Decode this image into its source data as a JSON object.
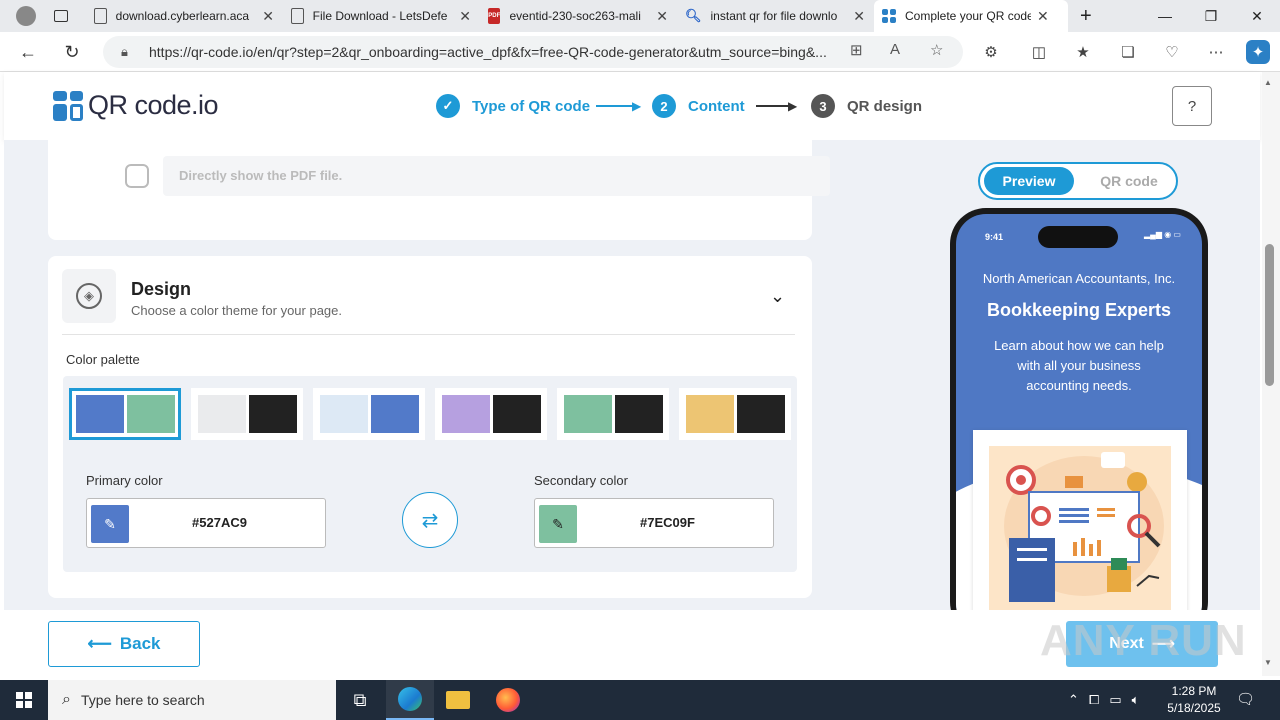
{
  "browser": {
    "tabs": [
      {
        "title": "download.cyberlearn.aca",
        "icon": "page-icon"
      },
      {
        "title": "File Download - LetsDefe",
        "icon": "page-icon"
      },
      {
        "title": "eventid-230-soc263-mali",
        "icon": "pdf-icon"
      },
      {
        "title": "instant qr for file downlo",
        "icon": "search-icon"
      },
      {
        "title": "Complete your QR code",
        "icon": "qrcode-favicon"
      }
    ],
    "url": "https://qr-code.io/en/qr?step=2&qr_onboarding=active_dpf&fx=free-QR-code-generator&utm_source=bing&..."
  },
  "site": {
    "logo_text": "QR code.io",
    "steps": [
      {
        "num": "✓",
        "label": "Type of QR code",
        "state": "done"
      },
      {
        "num": "2",
        "label": "Content",
        "state": "active"
      },
      {
        "num": "3",
        "label": "QR design",
        "state": "pending"
      }
    ],
    "help_icon": "?"
  },
  "content": {
    "pdf_option": "Directly show the PDF file.",
    "design": {
      "title": "Design",
      "subtitle": "Choose a color theme for your page.",
      "palette_label": "Color palette",
      "palettes": [
        {
          "primary": "#527AC9",
          "secondary": "#7EC09F",
          "selected": true
        },
        {
          "primary": "#EAEBED",
          "secondary": "#222222",
          "selected": false
        },
        {
          "primary": "#DDE9F5",
          "secondary": "#527AC9",
          "selected": false
        },
        {
          "primary": "#B6A0E0",
          "secondary": "#222222",
          "selected": false
        },
        {
          "primary": "#7EC09F",
          "secondary": "#222222",
          "selected": false
        },
        {
          "primary": "#EDC573",
          "secondary": "#222222",
          "selected": false
        }
      ],
      "primary_label": "Primary color",
      "primary_value": "#527AC9",
      "secondary_label": "Secondary color",
      "secondary_value": "#7EC09F"
    }
  },
  "preview": {
    "toggle_preview": "Preview",
    "toggle_qr": "QR code",
    "time": "9:41",
    "company": "North American Accountants, Inc.",
    "title": "Bookkeeping Experts",
    "description": "Learn about how we can help with all your business accounting needs."
  },
  "nav": {
    "back": "Back",
    "next": "Next"
  },
  "watermark": "ANY RUN",
  "taskbar": {
    "search_placeholder": "Type here to search",
    "time": "1:28 PM",
    "date": "5/18/2025"
  },
  "colors": {
    "accent": "#1E9AD6",
    "primary": "#527AC9",
    "secondary": "#7EC09F"
  }
}
